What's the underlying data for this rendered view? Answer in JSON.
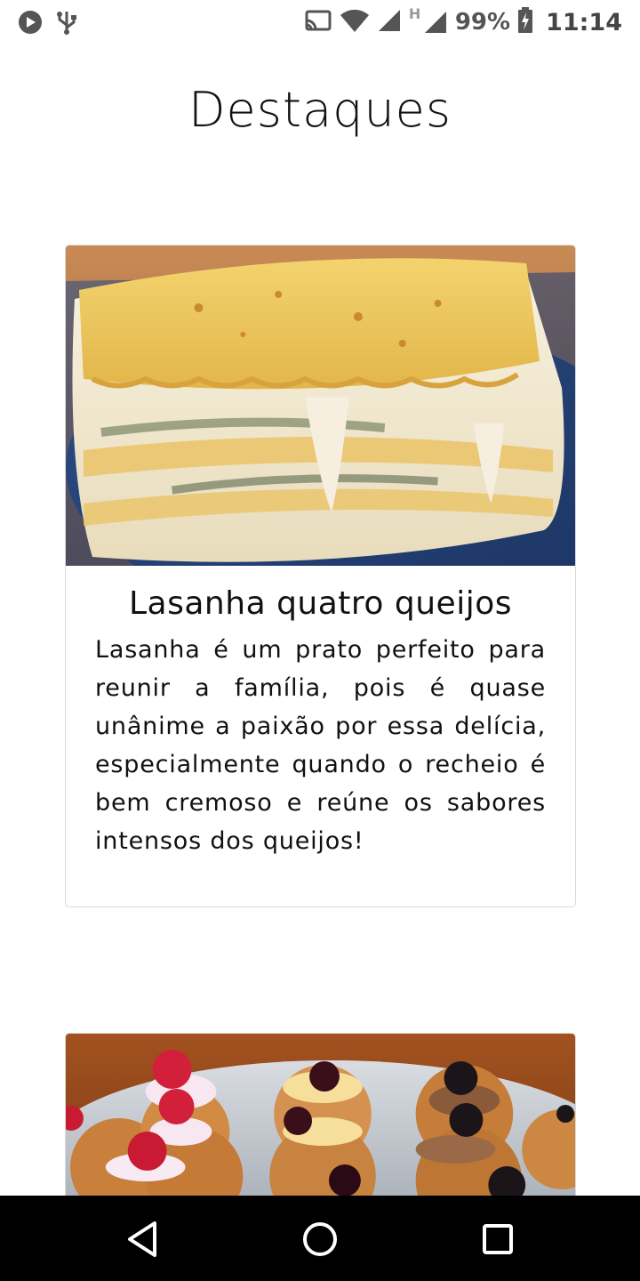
{
  "status_bar": {
    "icons_left": [
      "play-store-icon",
      "usb-icon"
    ],
    "icons_right": [
      "cast-icon",
      "wifi-icon",
      "signal-icon",
      "signal-h-icon",
      "battery-icon"
    ],
    "network_type": "H",
    "battery_percent": "99%",
    "time": "11:14"
  },
  "page": {
    "title": "Destaques"
  },
  "cards": [
    {
      "image_icon": "lasagna-photo",
      "title": "Lasanha quatro queijos",
      "description": "Lasanha é um prato perfeito para reunir a família, pois é quase unânime a paixão por essa delícia, especialmente quando o recheio é bem cremoso e reúne os sabores intensos dos queijos!"
    },
    {
      "image_icon": "cream-puff-pastries-photo"
    }
  ],
  "nav_bar": {
    "icons": [
      "back-icon",
      "home-icon",
      "recents-icon"
    ]
  },
  "colors": {
    "background": "#ffffff",
    "text": "#111111",
    "card_border": "#d9d9d9",
    "nav_bar": "#000000"
  }
}
